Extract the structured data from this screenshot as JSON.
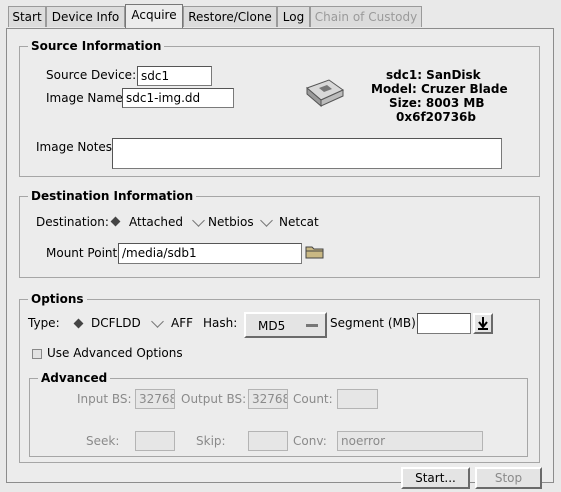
{
  "tabs": [
    {
      "label": "Start"
    },
    {
      "label": "Device Info"
    },
    {
      "label": "Acquire"
    },
    {
      "label": "Restore/Clone"
    },
    {
      "label": "Log"
    },
    {
      "label": "Chain of Custody"
    }
  ],
  "source": {
    "legend": "Source Information",
    "device_label": "Source Device:",
    "device_value": "sdc1",
    "image_label": "Image Name:",
    "image_value": "sdc1-img.dd",
    "notes_label": "Image Notes:",
    "notes_value": "",
    "device_info": {
      "line1": "sdc1: SanDisk",
      "line2": "Model: Cruzer Blade",
      "line3": "Size: 8003 MB",
      "line4": "0x6f20736b"
    }
  },
  "destination": {
    "legend": "Destination Information",
    "dest_label": "Destination:",
    "options": [
      "Attached",
      "Netbios",
      "Netcat"
    ],
    "selected": "Attached",
    "mount_label": "Mount Point:",
    "mount_value": "/media/sdb1"
  },
  "options": {
    "legend": "Options",
    "type_label": "Type:",
    "type_options": [
      "DCFLDD",
      "AFF"
    ],
    "type_selected": "DCFLDD",
    "hash_label": "Hash:",
    "hash_value": "MD5",
    "segment_label": "Segment (MB):",
    "segment_value": "",
    "advanced_check_label": "Use Advanced Options",
    "advanced": {
      "legend": "Advanced",
      "input_bs_label": "Input BS:",
      "input_bs_value": "32768",
      "output_bs_label": "Output BS:",
      "output_bs_value": "32768",
      "count_label": "Count:",
      "count_value": "",
      "seek_label": "Seek:",
      "seek_value": "",
      "skip_label": "Skip:",
      "skip_value": "",
      "conv_label": "Conv:",
      "conv_value": "noerror"
    }
  },
  "buttons": {
    "start": "Start...",
    "stop": "Stop"
  },
  "icons": {
    "usb": "usb-drive-icon",
    "folder": "folder-icon",
    "arrow": "download-arrow-icon"
  }
}
